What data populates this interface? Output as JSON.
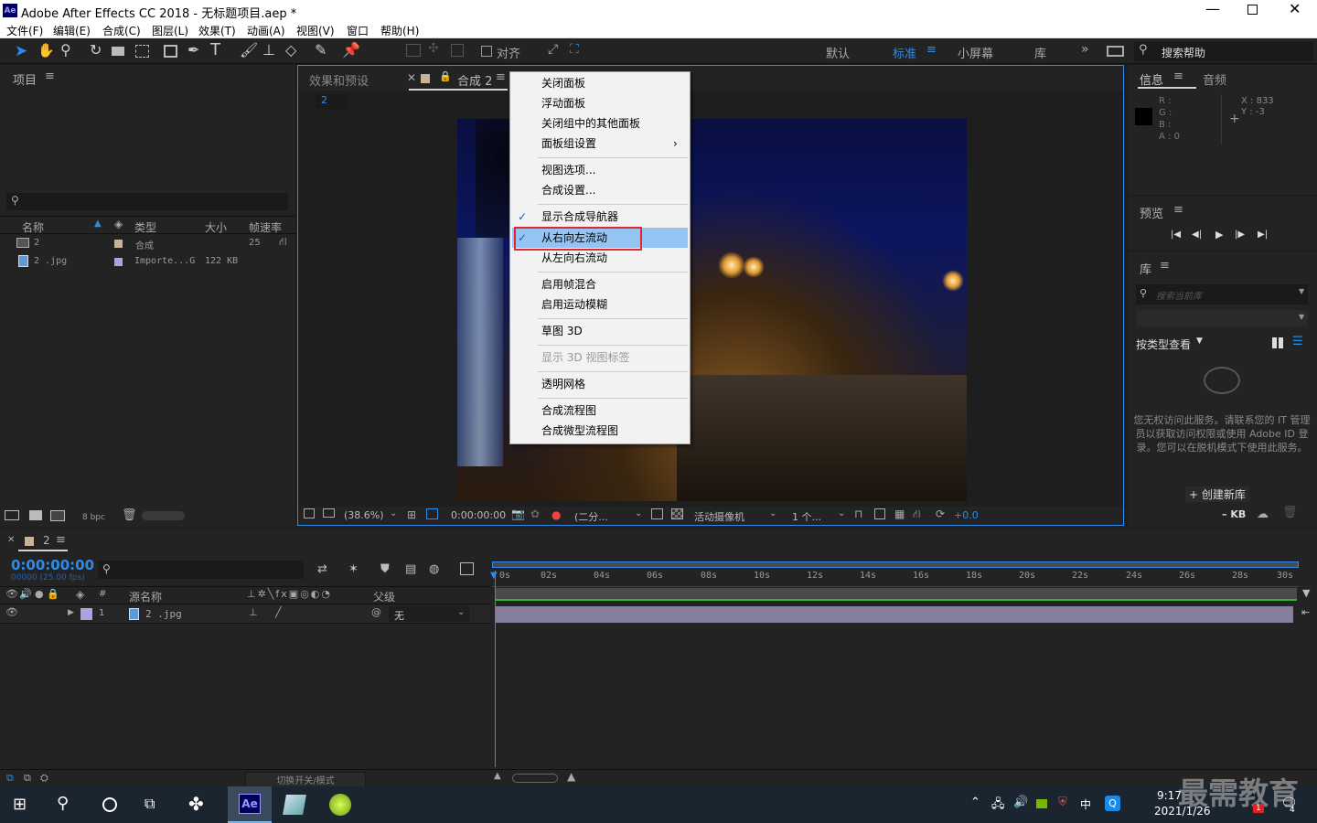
{
  "window": {
    "title": "Adobe After Effects CC 2018 - 无标题项目.aep *",
    "app_icon": "Ae"
  },
  "menubar": [
    "文件(F)",
    "编辑(E)",
    "合成(C)",
    "图层(L)",
    "效果(T)",
    "动画(A)",
    "视图(V)",
    "窗口",
    "帮助(H)"
  ],
  "toolbar": {
    "snap_label": "对齐",
    "workspaces": [
      "默认",
      "标准",
      "小屏幕",
      "库"
    ],
    "active_workspace": "标准",
    "search_help_placeholder": "搜索帮助"
  },
  "project_panel": {
    "title": "项目",
    "columns": [
      "名称",
      "类型",
      "大小",
      "帧速率"
    ],
    "rows": [
      {
        "name": "2",
        "type": "合成",
        "size": "",
        "fps": "25"
      },
      {
        "name": "2 .jpg",
        "type": "Importe...G",
        "size": "122 KB",
        "fps": ""
      }
    ],
    "bpc": "8 bpc"
  },
  "viewer": {
    "tabs": [
      "效果和预设",
      "合成 2"
    ],
    "comp_tag": "2",
    "zoom": "(38.6%)",
    "timecode": "0:00:00:00",
    "resolution": "(二分...",
    "camera": "活动摄像机",
    "views": "1 个...",
    "exposure": "+0.0"
  },
  "context_menu": {
    "items": [
      {
        "label": "关闭面板"
      },
      {
        "label": "浮动面板"
      },
      {
        "label": "关闭组中的其他面板"
      },
      {
        "label": "面板组设置",
        "submenu": true
      },
      {
        "label": "视图选项..."
      },
      {
        "label": "合成设置..."
      },
      {
        "label": "显示合成导航器",
        "checked": true
      },
      {
        "label": "从右向左流动",
        "checked": true,
        "highlighted": true
      },
      {
        "label": "从左向右流动"
      },
      {
        "label": "启用帧混合"
      },
      {
        "label": "启用运动模糊"
      },
      {
        "label": "草图 3D"
      },
      {
        "label": "显示 3D 视图标签",
        "disabled": true
      },
      {
        "label": "透明网格"
      },
      {
        "label": "合成流程图"
      },
      {
        "label": "合成微型流程图"
      }
    ]
  },
  "info_panel": {
    "tabs": [
      "信息",
      "音频"
    ],
    "r": "R :",
    "g": "G :",
    "b": "B :",
    "a": "A : 0",
    "x": "X : 833",
    "y": "Y : -3"
  },
  "preview_panel": {
    "title": "预览"
  },
  "library_panel": {
    "title": "库",
    "search_placeholder": "搜索当前库",
    "view_by": "按类型查看",
    "message": "您无权访问此服务。请联系您的 IT 管理员以获取访问权限或使用 Adobe ID 登录。您可以在脱机模式下使用此服务。",
    "create_button": "+ 创建新库",
    "size": "– KB"
  },
  "timeline": {
    "comp_name": "2",
    "timecode": "0:00:00:00",
    "fps_text": "00000 (25.00 fps)",
    "columns": {
      "source": "源名称",
      "parent": "父级",
      "num": "#"
    },
    "layers": [
      {
        "num": "1",
        "name": "2 .jpg",
        "parent": "无"
      }
    ],
    "ticks": [
      "0s",
      "02s",
      "04s",
      "06s",
      "08s",
      "10s",
      "12s",
      "14s",
      "16s",
      "18s",
      "20s",
      "22s",
      "24s",
      "26s",
      "28s",
      "30s"
    ],
    "switch_modes": "切换开关/模式"
  },
  "taskbar": {
    "time": "9:17",
    "date": "2021/1/26",
    "ime": "中",
    "watermark": "最需教育",
    "notif_count": "4",
    "badge": "1"
  },
  "colors": {
    "accent": "#2d8ceb",
    "highlight": "#94c4f2",
    "red_box": "#e0282e"
  }
}
